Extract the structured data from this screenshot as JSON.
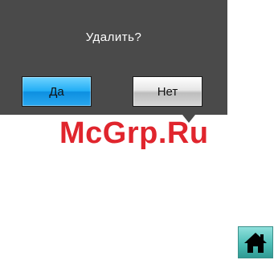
{
  "dialog": {
    "title": "Удалить?",
    "yes_label": "Да",
    "no_label": "Нет"
  },
  "watermark": {
    "text": "McGrp.Ru"
  },
  "icons": {
    "home": "home-icon"
  },
  "colors": {
    "dialog_bg": "#4a4a4a",
    "yes_button": "#22aef5",
    "no_button": "#d6d6d6",
    "watermark": "#e0252d",
    "home_button": "#4cbdb6"
  }
}
